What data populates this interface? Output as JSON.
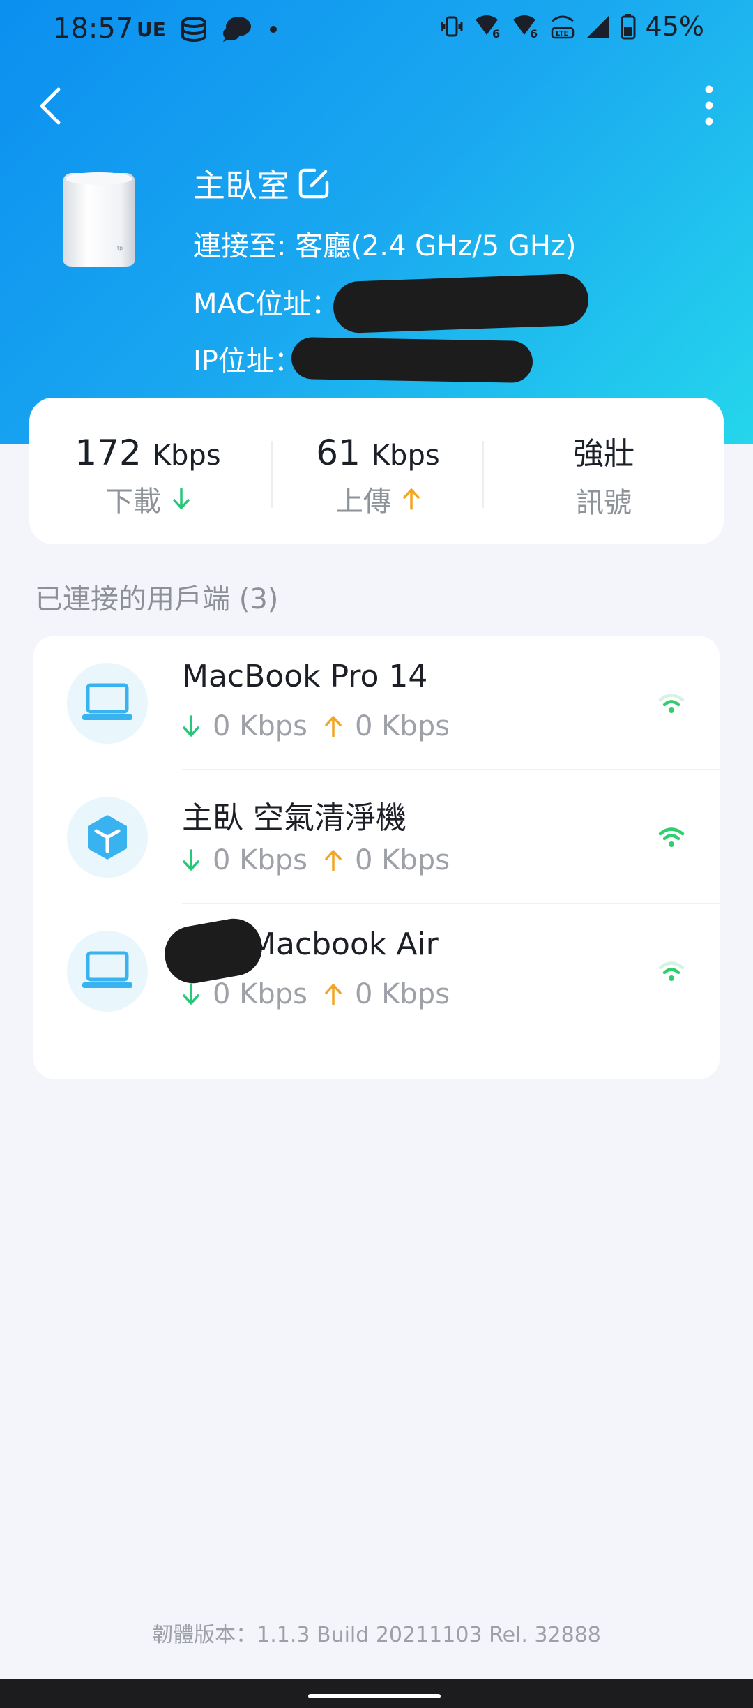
{
  "status_bar": {
    "time": "18:57",
    "carrier_icon_text": "UE",
    "battery": "45%",
    "icons": [
      "data-saver-icon",
      "messenger-icon",
      "dot-icon",
      "vibrate-icon",
      "wifi6-icon",
      "wifi6-icon",
      "volte-icon",
      "cell-signal-icon",
      "battery-icon"
    ]
  },
  "header": {
    "device_name": "主臥室",
    "connected_to": "連接至: 客廳(2.4 GHz/5 GHz)",
    "mac_label": "MAC位址：",
    "ip_label": "IP位址："
  },
  "stats": {
    "download": {
      "value": "172",
      "unit": "Kbps",
      "label": "下載"
    },
    "upload": {
      "value": "61",
      "unit": "Kbps",
      "label": "上傳"
    },
    "signal": {
      "value": "強壯",
      "label": "訊號"
    }
  },
  "clients_section": {
    "title": "已連接的用戶端 (3)"
  },
  "clients": [
    {
      "name": "MacBook Pro 14",
      "down": "0 Kbps",
      "up": "0 Kbps",
      "icon": "laptop-icon",
      "signal": "weak"
    },
    {
      "name": "主臥 空氣清淨機",
      "down": "0 Kbps",
      "up": "0 Kbps",
      "icon": "smart-device-icon",
      "signal": "strong"
    },
    {
      "name": "Macbook Air",
      "down": "0 Kbps",
      "up": "0 Kbps",
      "icon": "laptop-icon",
      "signal": "weak"
    }
  ],
  "footer": {
    "firmware": "韌體版本：1.1.3 Build 20211103 Rel. 32888"
  },
  "colors": {
    "header_gradient_start": "#0b8ff0",
    "header_gradient_end": "#25d6ec",
    "download_arrow": "#27c77a",
    "upload_arrow": "#f3a420",
    "wifi_green": "#2fcf6e",
    "laptop_blue": "#38b3f0",
    "background": "#f4f5fa"
  }
}
